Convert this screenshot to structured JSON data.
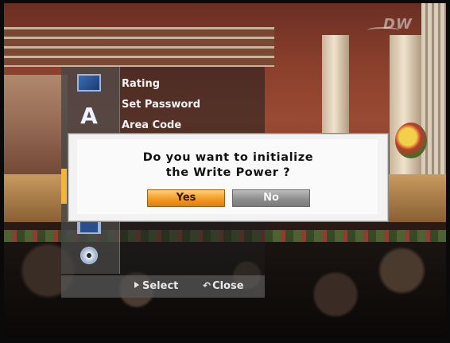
{
  "overlay": {
    "watermark_text": "DW",
    "menu": {
      "items": [
        {
          "label": "Rating"
        },
        {
          "label": "Set Password"
        },
        {
          "label": "Area Code"
        }
      ],
      "icons": [
        "film-icon",
        "language-icon",
        "recording-icon",
        "disc-icon"
      ],
      "accent_color": "#f4b637"
    },
    "footer": {
      "select_label": "Select",
      "close_label": "Close"
    },
    "dialog": {
      "line1": "Do you want to initialize",
      "line2": "the Write Power ?",
      "yes_label": "Yes",
      "no_label": "No",
      "selected_button": "Yes"
    }
  }
}
